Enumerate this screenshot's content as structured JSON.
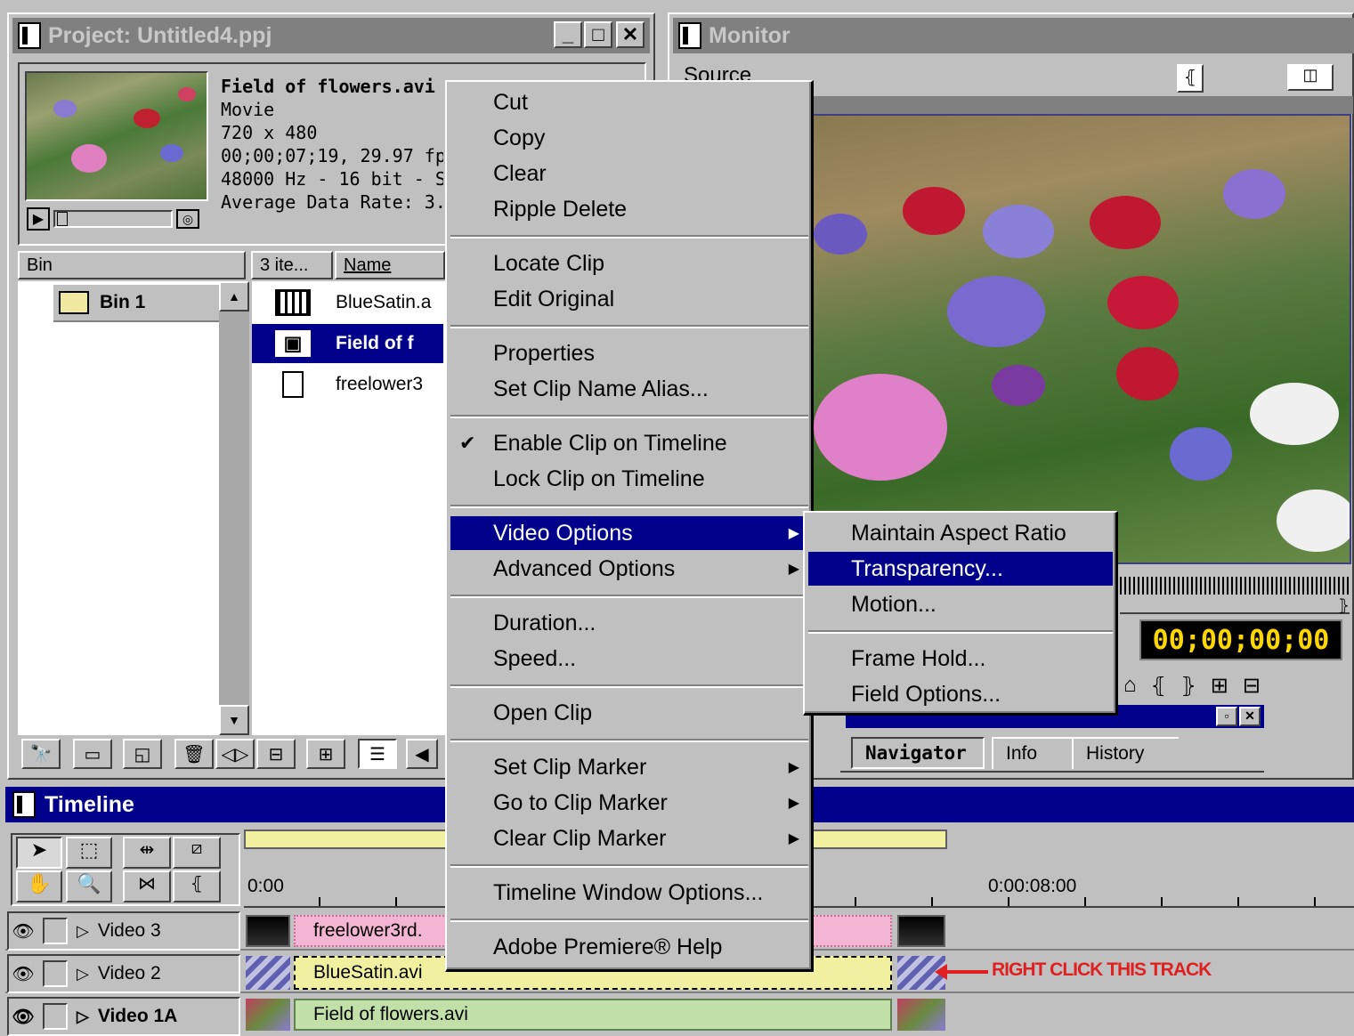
{
  "project": {
    "title": "Project: Untitled4.ppj",
    "clip_name": "Field of flowers.avi",
    "clip_type": "Movie",
    "dimensions": "720 x 480",
    "duration": "00;00;07;19, 29.97 fp:",
    "audio": "48000 Hz - 16 bit - Ste",
    "data_rate": "Average Data Rate: 3.62",
    "bin_header": "Bin",
    "items_header": "3 ite...",
    "name_header": "Name",
    "bin_name": "Bin 1",
    "items": [
      {
        "name": "BlueSatin.a",
        "icon": "filmstrip-icon"
      },
      {
        "name": "Field of f",
        "icon": "movie-clip-icon"
      },
      {
        "name": "freelower3",
        "icon": "still-image-icon"
      }
    ]
  },
  "monitor": {
    "title": "Monitor",
    "source_tab": "Source",
    "timecode": "00;00;00;00"
  },
  "navigator": {
    "tabs": [
      "Navigator",
      "Info",
      "History"
    ]
  },
  "timeline": {
    "title": "Timeline",
    "time_start": "0:00",
    "time_mark": "0:00:08:00",
    "annotation": "RIGHT CLICK THIS TRACK",
    "tracks": [
      {
        "name": "Video 3",
        "clip": "freelower3rd."
      },
      {
        "name": "Video 2",
        "clip": "BlueSatin.avi"
      },
      {
        "name": "Video 1A",
        "clip": "Field of flowers.avi"
      }
    ]
  },
  "context_menu": {
    "items": [
      "Cut",
      "Copy",
      "Clear",
      "Ripple Delete",
      "Locate Clip",
      "Edit Original",
      "Properties",
      "Set Clip Name Alias...",
      "Enable Clip on Timeline",
      "Lock Clip on Timeline",
      "Video Options",
      "Advanced Options",
      "Duration...",
      "Speed...",
      "Open Clip",
      "Set Clip Marker",
      "Go to Clip Marker",
      "Clear Clip Marker",
      "Timeline Window Options...",
      "Adobe Premiere® Help"
    ]
  },
  "submenu": {
    "items": [
      "Maintain Aspect Ratio",
      "Transparency...",
      "Motion...",
      "Frame Hold...",
      "Field Options..."
    ]
  },
  "colors": {
    "title_active": "#00008b",
    "highlight": "#00008b",
    "clip_pink": "#f4b4d4",
    "clip_yellow": "#f0f0a0",
    "clip_green": "#c0e0a8",
    "annotation": "#e02020"
  }
}
